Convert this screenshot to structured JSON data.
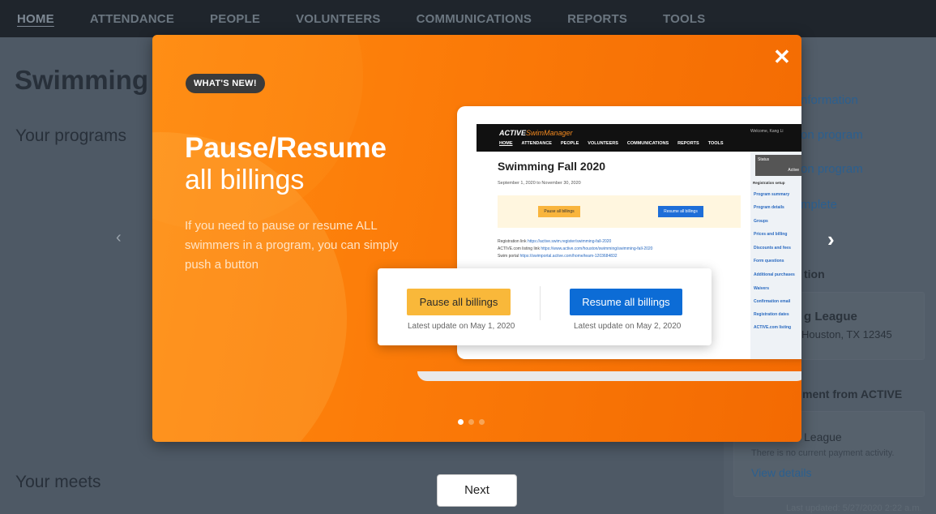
{
  "nav": {
    "items": [
      "HOME",
      "ATTENDANCE",
      "PEOPLE",
      "VOLUNTEERS",
      "COMMUNICATIONS",
      "REPORTS",
      "TOOLS"
    ],
    "active": "HOME"
  },
  "background": {
    "page_title": "Swimming",
    "programs_heading": "Your programs",
    "meets_heading": "Your meets",
    "side": {
      "link1": "nformation",
      "link2": "on program",
      "link3": "on program",
      "link4": "mplete",
      "section1": "tion",
      "org_name": "g League",
      "org_address": "Houston, TX 12345",
      "section2": "ment from ACTIVE",
      "org_name2": "League",
      "no_activity": "There is no current payment activity.",
      "view_details": "View details",
      "last_updated": "Last updated: 5/27/2020 2:22 a.m."
    }
  },
  "modal": {
    "badge": "WHAT'S NEW!",
    "title": "Pause/Resume",
    "subtitle": "all billings",
    "description": "If you need to pause or resume ALL swimmers in a program, you can simply push a button",
    "close_icon": "close-icon",
    "prev_icon": "chevron-left-icon",
    "next_icon": "chevron-right-icon",
    "slides_total": 3,
    "slide_active": 1,
    "preview": {
      "brand_prefix": "ACTIVE",
      "brand_suffix": "SwimManager",
      "welcome": "Welcome, Kang Li",
      "nav": [
        "HOME",
        "ATTENDANCE",
        "PEOPLE",
        "VOLUNTEERS",
        "COMMUNICATIONS",
        "REPORTS",
        "TOOLS"
      ],
      "heading": "Swimming Fall 2020",
      "dates": "September 1, 2020 to November 30, 2020",
      "pause_btn": "Pause all billings",
      "resume_btn": "Resume all billings",
      "reg_link_label": "Registration link",
      "reg_link": "https://active.swim.register/swimming-fall-2020",
      "listing_label": "ACTIVE.com listing link",
      "listing_link": "https://www.active.com/houston/swimming/swimming-fall-2020",
      "portal_label": "Swim portal",
      "portal_link": "https://swimportal.active.com/home/team-1203684832",
      "status_label": "Status",
      "status_value": "Active",
      "setup_label": "Registration setup",
      "side_items": [
        "Program summary",
        "Program details",
        "Groups",
        "Prices and billing",
        "Discounts and fees",
        "Form questions",
        "Additional purchases",
        "Waivers",
        "Confirmation email",
        "Registration dates",
        "ACTIVE.com listing"
      ]
    },
    "card": {
      "pause_btn": "Pause all billings",
      "pause_note": "Latest update on May 1, 2020",
      "resume_btn": "Resume all billings",
      "resume_note": "Latest update on May 2, 2020"
    }
  },
  "next_button": "Next",
  "colors": {
    "accent_orange": "#fb7a08",
    "resume_blue": "#0c6cd6",
    "pause_yellow": "#f9b83a"
  }
}
